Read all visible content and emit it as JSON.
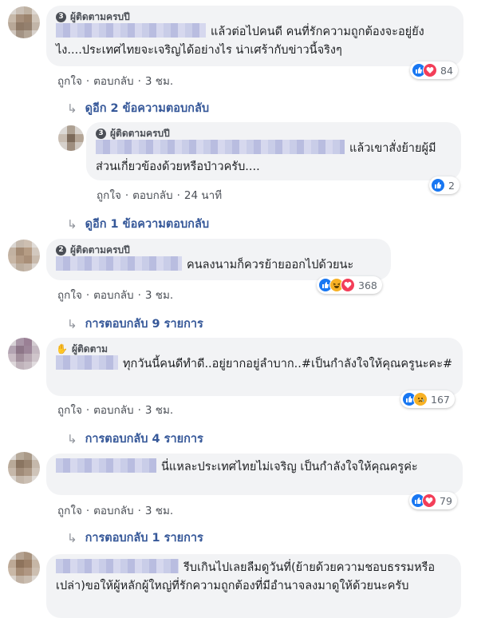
{
  "badges": {
    "fan": "ผู้ติดตามครบปี",
    "follower": "ผู้ติดตาม",
    "num3": "3",
    "num2": "2"
  },
  "comments": [
    {
      "text": "แล้วต่อไปคนดี คนที่รักความถูกต้องจะอยู่ยังไง....ประเทศไทยจะเจริญได้อย่างไร น่าเศร้ากับข่าวนี้จริงๆ",
      "like": "ถูกใจ",
      "reply": "ตอบกลับ",
      "time": "3 ชม.",
      "reactions": "84",
      "more": "ดูอีก 2 ข้อความตอบกลับ"
    },
    {
      "text": "แล้วเขาสั่งย้ายผู้มีส่วนเกี่ยวข้องด้วยหรือป่าวครับ....",
      "like": "ถูกใจ",
      "reply": "ตอบกลับ",
      "time": "24 นาที",
      "reactions": "2",
      "more": "ดูอีก 1 ข้อความตอบกลับ"
    },
    {
      "text": "คนลงนามก็ควรย้ายออกไปด้วยนะ",
      "like": "ถูกใจ",
      "reply": "ตอบกลับ",
      "time": "3 ชม.",
      "reactions": "368",
      "more": "การตอบกลับ 9 รายการ"
    },
    {
      "text": "ทุกวันนี้คนดีทำดี..อยู่ยากอยู่ลำบาก..#เป็นกำลังใจให้คุณครูนะคะ#",
      "like": "ถูกใจ",
      "reply": "ตอบกลับ",
      "time": "3 ชม.",
      "reactions": "167",
      "more": "การตอบกลับ 4 รายการ"
    },
    {
      "text": "นี่แหละประเทศไทยไม่เจริญ เป็นกำลังใจให้คุณครูค่ะ",
      "like": "ถูกใจ",
      "reply": "ตอบกลับ",
      "time": "3 ชม.",
      "reactions": "79",
      "more": "การตอบกลับ 1 รายการ"
    },
    {
      "text": "รีบเกินไปเลยลืมดูวันที่(ย้ายด้วยความชอบธรรมหรือเปล่า)ขอให้ผู้หลักผู้ใหญ่ที่รักความถูกต้องที่มีอำนาจลงมาดูให้ด้วยนะครับ"
    }
  ],
  "colors": {
    "like": "#1877f2",
    "love": "#f33e58",
    "haha": "#f7b125",
    "link": "#365899",
    "bubble": "#f2f3f5",
    "meta": "#4b4f56"
  },
  "icons": [
    "like-icon",
    "love-icon",
    "haha-icon",
    "sad-icon",
    "reply-arrow-icon",
    "wave-icon"
  ]
}
